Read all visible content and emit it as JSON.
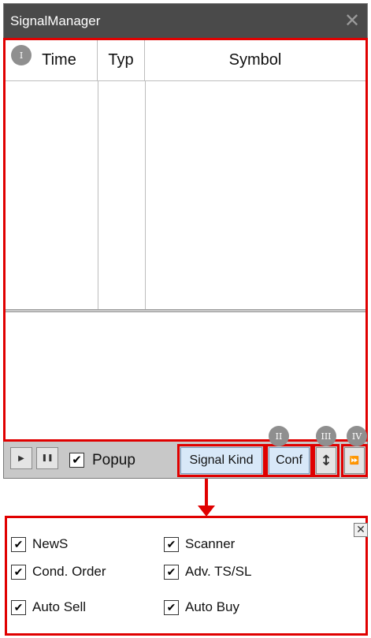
{
  "window": {
    "title": "SignalManager",
    "close_glyph": "✕"
  },
  "table": {
    "columns": [
      "Time",
      "Typ",
      "Symbol"
    ]
  },
  "badges": {
    "i": "I",
    "ii": "II",
    "iii": "III",
    "iv": "IV"
  },
  "toolbar": {
    "play_glyph": "▶",
    "pause_glyph": "❚❚",
    "popup_checked": true,
    "popup_label": "Popup",
    "signal_kind_label": "Signal Kind",
    "conf_label": "Conf",
    "sort_glyph": "↕",
    "forward_glyph": "⏩"
  },
  "signal_kind_panel": {
    "close_glyph": "✕",
    "options": [
      {
        "label": "NewS",
        "checked": true
      },
      {
        "label": "Scanner",
        "checked": true
      },
      {
        "label": "Cond. Order",
        "checked": true
      },
      {
        "label": "Adv. TS/SL",
        "checked": true
      },
      {
        "label": "Auto Sell",
        "checked": true
      },
      {
        "label": "Auto Buy",
        "checked": true
      }
    ]
  },
  "colors": {
    "highlight": "#e00000",
    "titlebar": "#4a4a4a",
    "button_bg": "#d8e8f8"
  },
  "check_glyph": "✔"
}
